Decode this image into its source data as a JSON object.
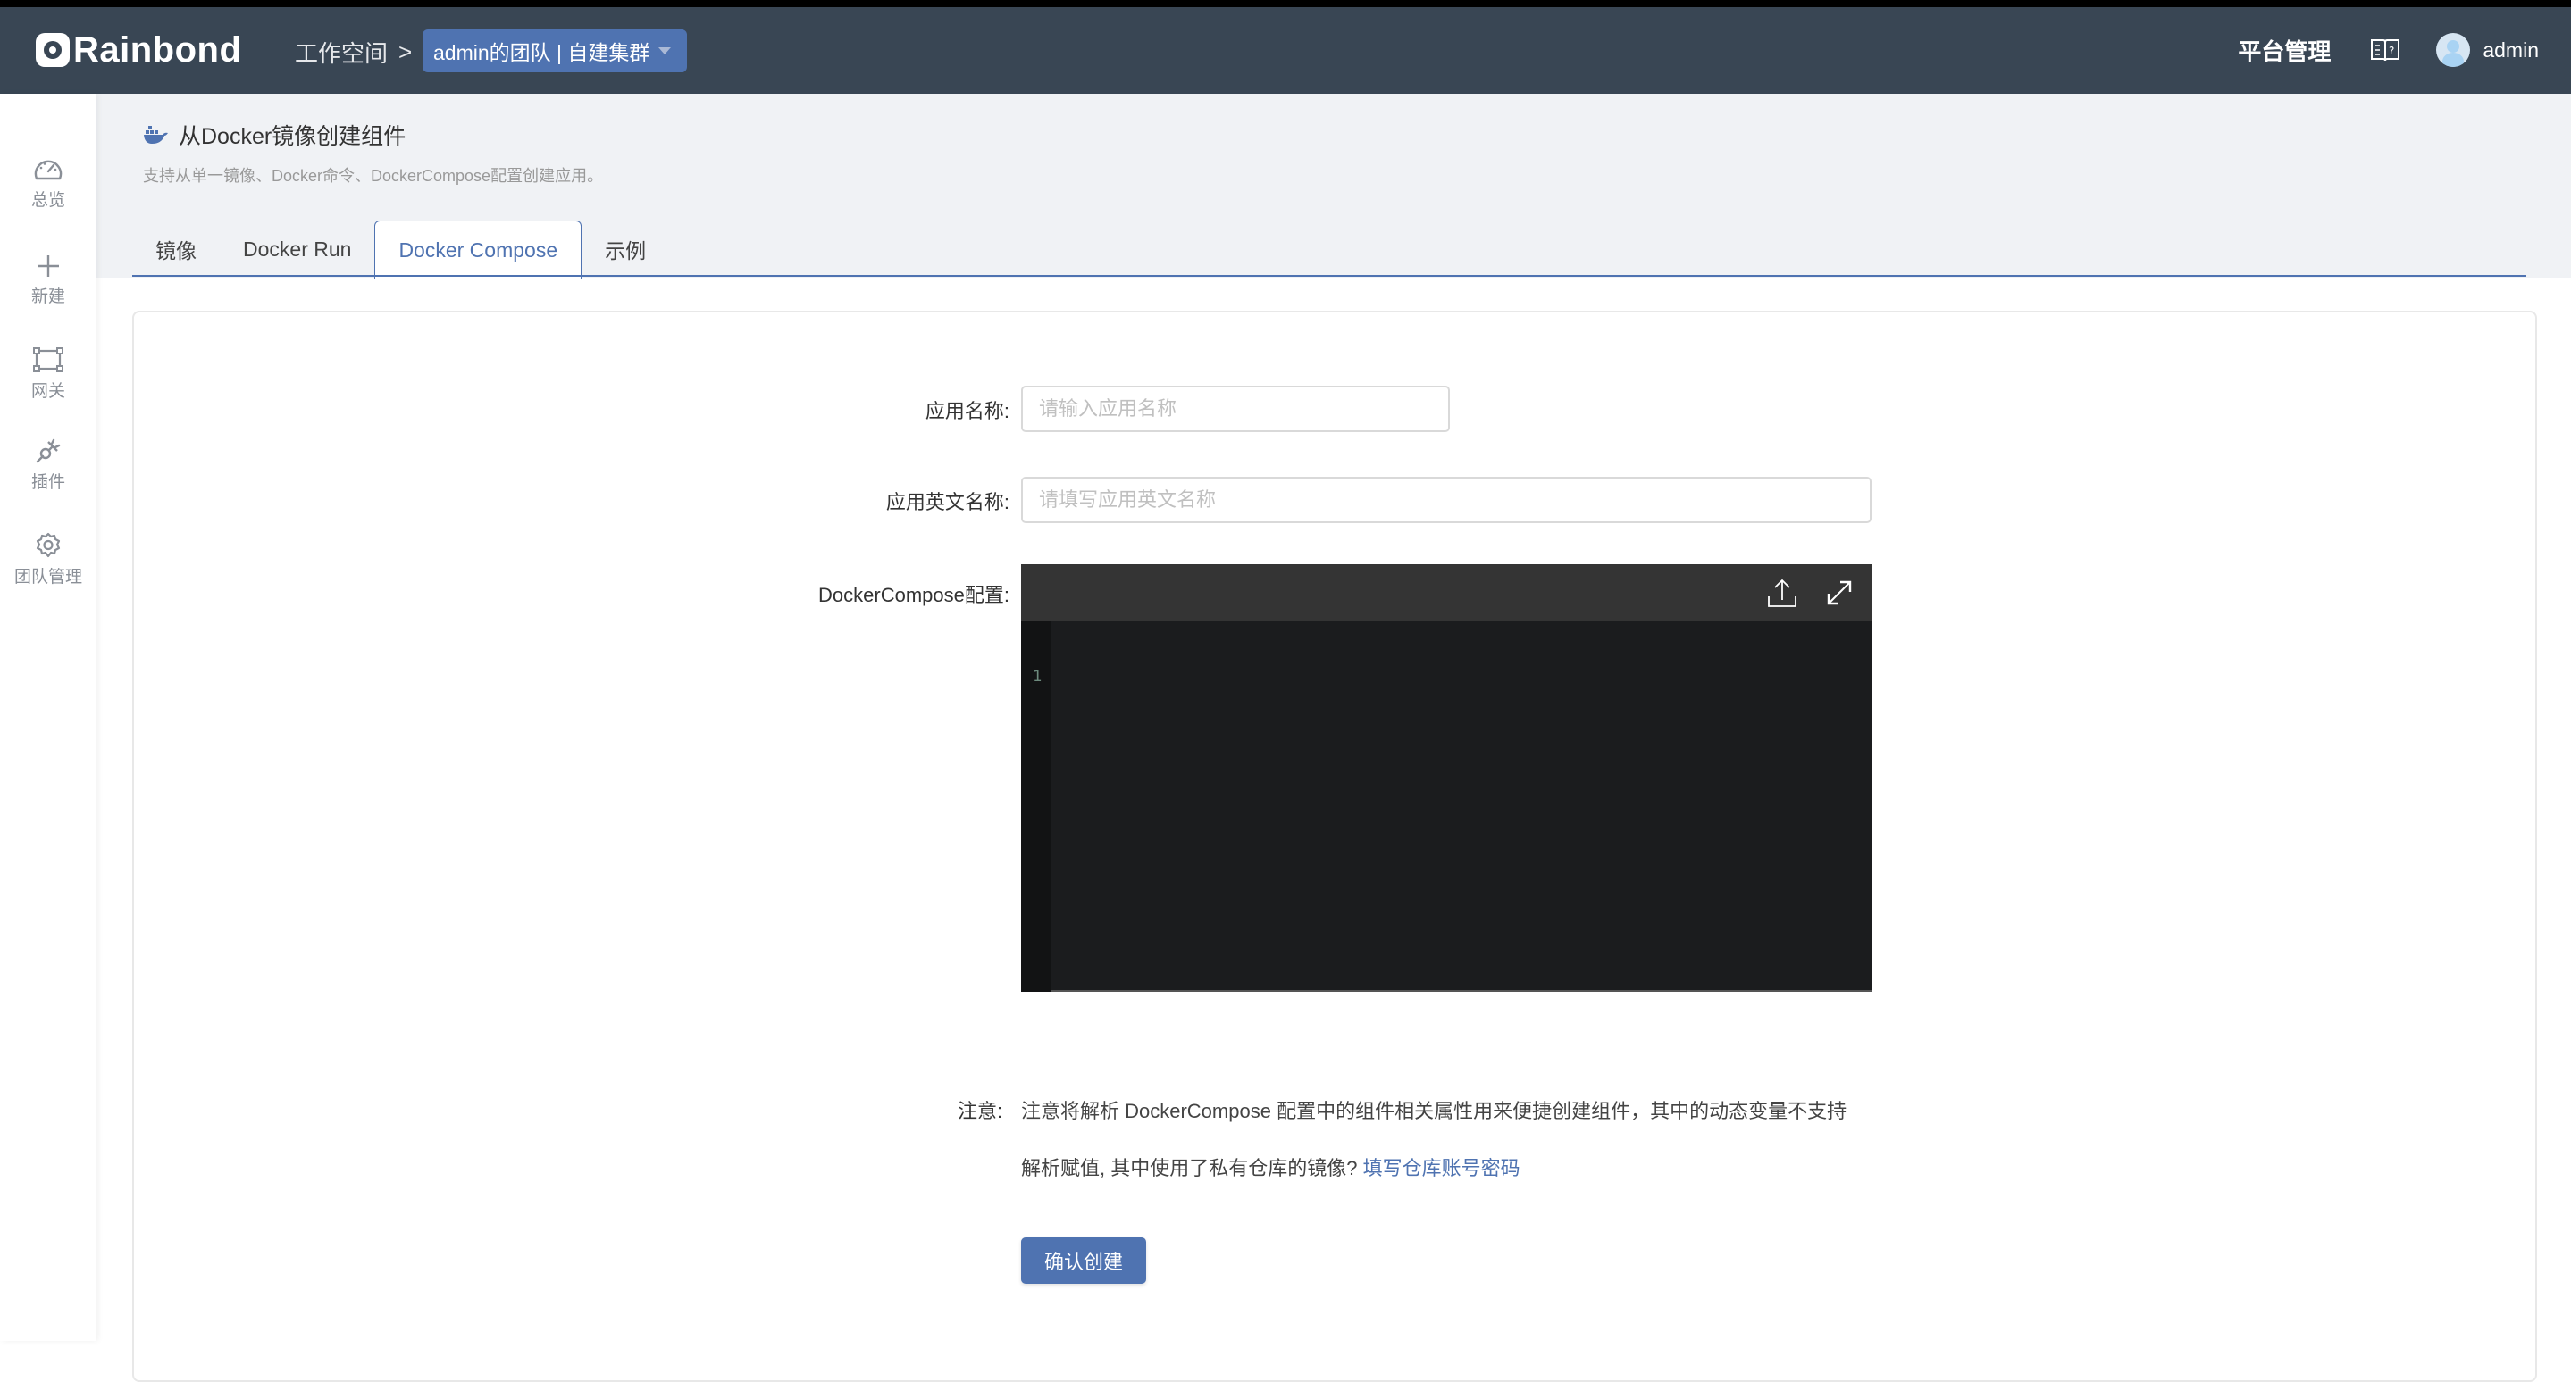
{
  "header": {
    "logo_text": "Rainbond",
    "breadcrumb_workspace": "工作空间",
    "breadcrumb_separator": ">",
    "team_select": "admin的团队 | 自建集群",
    "platform_admin": "平台管理",
    "docs_icon": "book-question-icon",
    "username": "admin"
  },
  "sidebar": {
    "items": [
      {
        "label": "总览",
        "icon": "dashboard-gauge-icon"
      },
      {
        "label": "新建",
        "icon": "plus-icon"
      },
      {
        "label": "网关",
        "icon": "gateway-nodes-icon"
      },
      {
        "label": "插件",
        "icon": "plug-icon"
      },
      {
        "label": "团队管理",
        "icon": "gear-icon"
      }
    ]
  },
  "page": {
    "title": "从Docker镜像创建组件",
    "title_icon": "docker-whale-icon",
    "subtitle": "支持从单一镜像、Docker命令、DockerCompose配置创建应用。",
    "tabs": [
      {
        "label": "镜像",
        "active": false
      },
      {
        "label": "Docker Run",
        "active": false
      },
      {
        "label": "Docker Compose",
        "active": true
      },
      {
        "label": "示例",
        "active": false
      }
    ]
  },
  "form": {
    "app_name_label": "应用名称:",
    "app_name_value": "",
    "app_name_placeholder": "请输入应用名称",
    "app_en_name_label": "应用英文名称:",
    "app_en_name_value": "",
    "app_en_name_placeholder": "请填写应用英文名称",
    "compose_label": "DockerCompose配置:",
    "editor": {
      "line_numbers": [
        "1"
      ],
      "content": "",
      "upload_icon": "upload-icon",
      "fullscreen_icon": "expand-icon"
    },
    "note_label": "注意:",
    "note_line1": "注意将解析 DockerCompose 配置中的组件相关属性用来便捷创建组件，其中的动态变量不支持",
    "note_line2": "解析赋值, 其中使用了私有仓库的镜像? ",
    "note_link": "填写仓库账号密码",
    "submit_label": "确认创建"
  },
  "colors": {
    "header_bg": "#394654",
    "primary": "#4f73b1",
    "page_bg": "#f0f2f5",
    "editor_bg": "#1b1c1e",
    "editor_toolbar": "#343434"
  }
}
